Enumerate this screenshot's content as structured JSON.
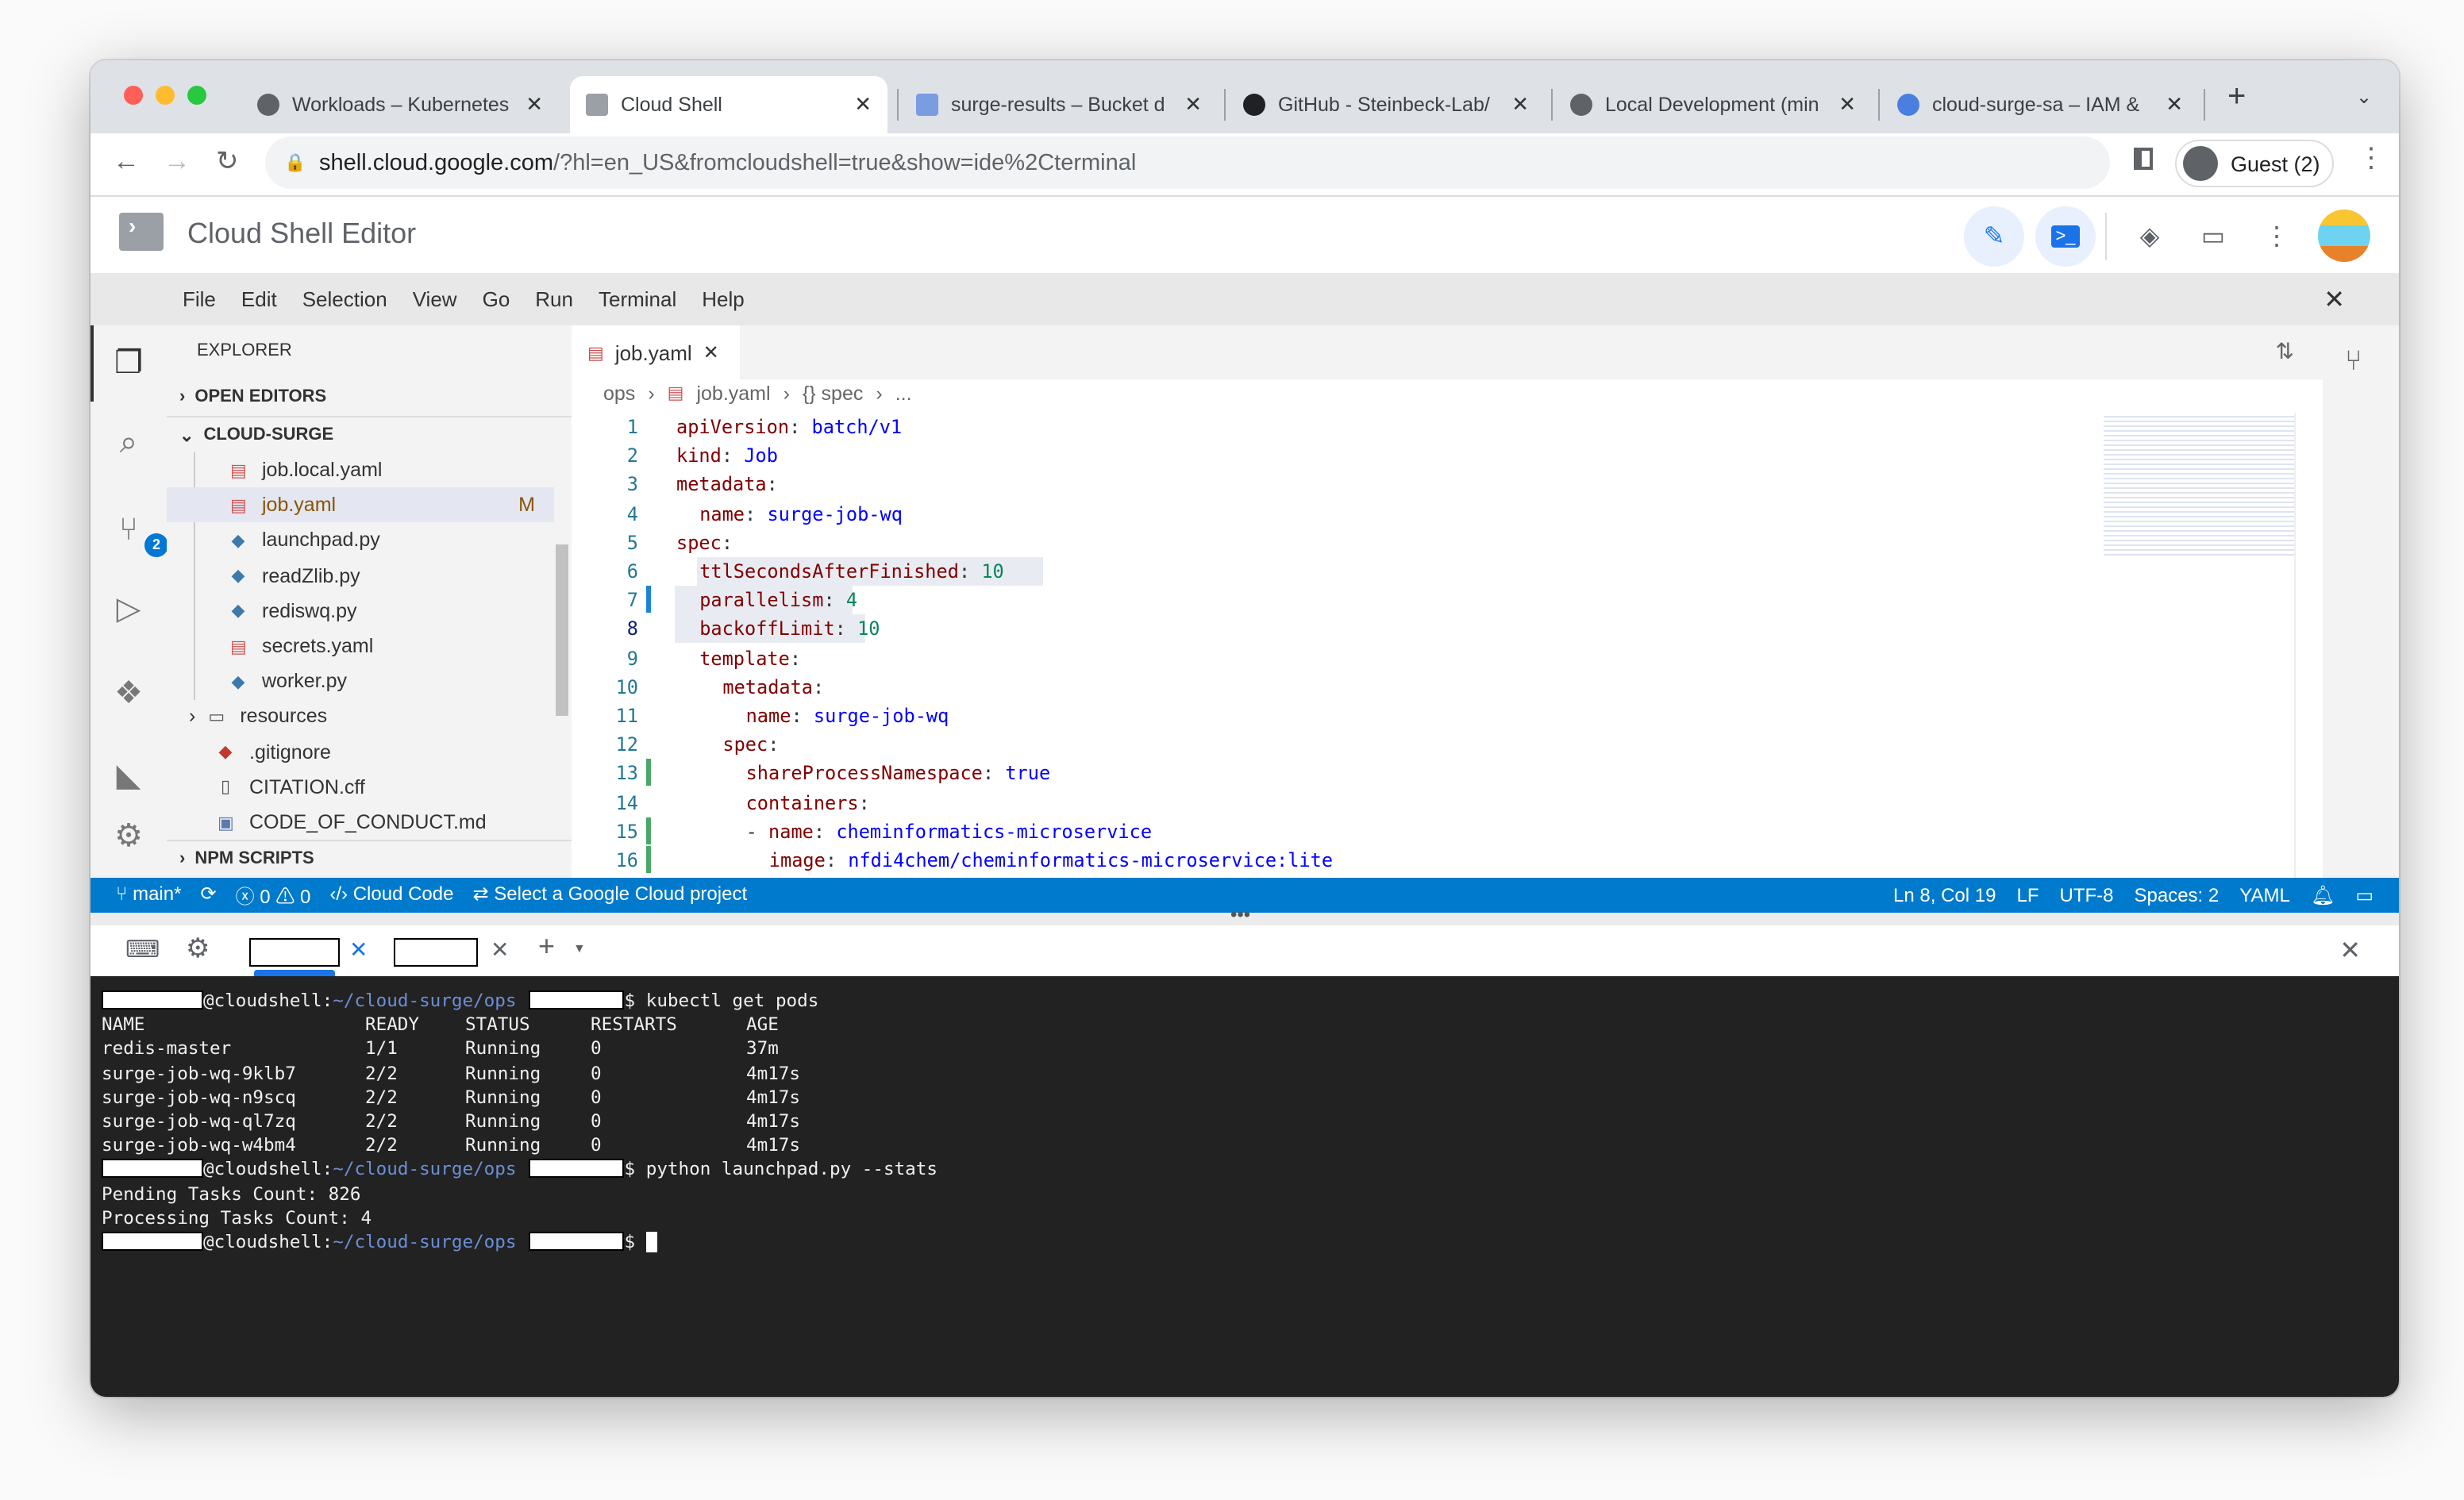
{
  "browser": {
    "tabs": [
      {
        "title": "Workloads – Kubernetes",
        "active": false
      },
      {
        "title": "Cloud Shell",
        "active": true
      },
      {
        "title": "surge-results – Bucket d",
        "active": false
      },
      {
        "title": "GitHub - Steinbeck-Lab/",
        "active": false
      },
      {
        "title": "Local Development (min",
        "active": false
      },
      {
        "title": "cloud-surge-sa – IAM &",
        "active": false
      }
    ],
    "url_host": "shell.cloud.google.com",
    "url_rest": "/?hl=en_US&fromcloudshell=true&show=ide%2Cterminal",
    "profile": "Guest (2)"
  },
  "app": {
    "title": "Cloud Shell Editor"
  },
  "menu": [
    "File",
    "Edit",
    "Selection",
    "View",
    "Go",
    "Run",
    "Terminal",
    "Help"
  ],
  "activity": {
    "scm_badge": "2"
  },
  "explorer": {
    "title": "EXPLORER",
    "open_editors": "OPEN EDITORS",
    "project": "CLOUD-SURGE",
    "npm": "NPM SCRIPTS",
    "files": [
      {
        "name": "job.local.yaml",
        "icon": "yaml"
      },
      {
        "name": "job.yaml",
        "icon": "yaml",
        "status": "M",
        "selected": true
      },
      {
        "name": "launchpad.py",
        "icon": "python"
      },
      {
        "name": "readZlib.py",
        "icon": "python"
      },
      {
        "name": "rediswq.py",
        "icon": "python"
      },
      {
        "name": "secrets.yaml",
        "icon": "yaml"
      },
      {
        "name": "worker.py",
        "icon": "python"
      }
    ],
    "root_items": [
      {
        "name": "resources",
        "icon": "folder"
      },
      {
        "name": ".gitignore",
        "icon": "git"
      },
      {
        "name": "CITATION.cff",
        "icon": "file"
      },
      {
        "name": "CODE_OF_CONDUCT.md",
        "icon": "markdown"
      }
    ]
  },
  "editor": {
    "tab": "job.yaml",
    "breadcrumb": [
      "ops",
      "job.yaml",
      "{} spec",
      "..."
    ],
    "lines": [
      {
        "indent": 0,
        "key": "apiVersion",
        "val": "batch/v1",
        "type": "v"
      },
      {
        "indent": 0,
        "key": "kind",
        "val": "Job",
        "type": "v"
      },
      {
        "indent": 0,
        "key": "metadata",
        "val": "",
        "type": "v"
      },
      {
        "indent": 1,
        "key": "name",
        "val": "surge-job-wq",
        "type": "v"
      },
      {
        "indent": 0,
        "key": "spec",
        "val": "",
        "type": "v"
      },
      {
        "indent": 1,
        "key": "ttlSecondsAfterFinished",
        "val": "10",
        "type": "n"
      },
      {
        "indent": 1,
        "key": "parallelism",
        "val": "4",
        "type": "n"
      },
      {
        "indent": 1,
        "key": "backoffLimit",
        "val": "10",
        "type": "n"
      },
      {
        "indent": 1,
        "key": "template",
        "val": "",
        "type": "v"
      },
      {
        "indent": 2,
        "key": "metadata",
        "val": "",
        "type": "v"
      },
      {
        "indent": 3,
        "key": "name",
        "val": "surge-job-wq",
        "type": "v"
      },
      {
        "indent": 2,
        "key": "spec",
        "val": "",
        "type": "v"
      },
      {
        "indent": 3,
        "key": "shareProcessNamespace",
        "val": "true",
        "type": "v"
      },
      {
        "indent": 3,
        "key": "containers",
        "val": "",
        "type": "v"
      },
      {
        "indent": 3,
        "key": "- name",
        "val": "cheminformatics-microservice",
        "type": "v"
      },
      {
        "indent": 4,
        "key": "image",
        "val": "nfdi4chem/cheminformatics-microservice:lite",
        "type": "v"
      }
    ]
  },
  "status": {
    "branch": "main*",
    "errors": "0",
    "warnings": "0",
    "cloud_code": "Cloud Code",
    "project": "Select a Google Cloud project",
    "position": "Ln 8, Col 19",
    "eol": "LF",
    "encoding": "UTF-8",
    "spaces": "Spaces: 2",
    "language": "YAML"
  },
  "terminal": {
    "host": "@cloudshell:",
    "path": "~/cloud-surge/ops",
    "cmd1": "kubectl get pods",
    "headers": [
      "NAME",
      "READY",
      "STATUS",
      "RESTARTS",
      "AGE"
    ],
    "pods": [
      [
        "redis-master",
        "1/1",
        "Running",
        "0",
        "37m"
      ],
      [
        "surge-job-wq-9klb7",
        "2/2",
        "Running",
        "0",
        "4m17s"
      ],
      [
        "surge-job-wq-n9scq",
        "2/2",
        "Running",
        "0",
        "4m17s"
      ],
      [
        "surge-job-wq-ql7zq",
        "2/2",
        "Running",
        "0",
        "4m17s"
      ],
      [
        "surge-job-wq-w4bm4",
        "2/2",
        "Running",
        "0",
        "4m17s"
      ]
    ],
    "cmd2": "python launchpad.py --stats",
    "out": [
      "Pending Tasks Count: 826",
      "Processing Tasks Count: 4"
    ]
  }
}
